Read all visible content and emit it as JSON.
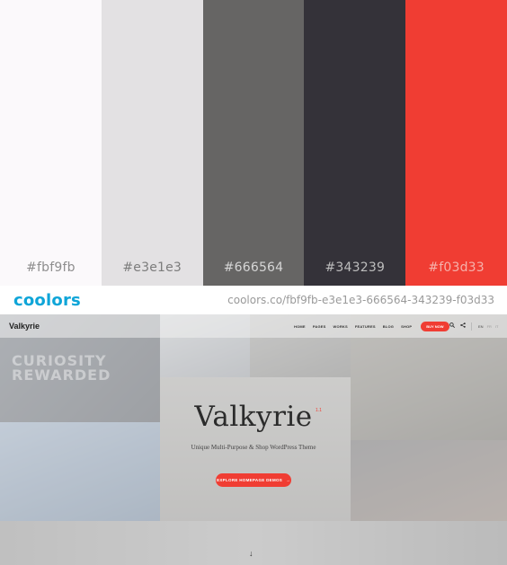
{
  "palette": {
    "swatches": [
      {
        "hex": "#fbf9fb",
        "label": "#fbf9fb",
        "label_color": "#8e8e8e"
      },
      {
        "hex": "#e3e1e3",
        "label": "#e3e1e3",
        "label_color": "#7c7c7c"
      },
      {
        "hex": "#666564",
        "label": "#666564",
        "label_color": "#d6d6d6"
      },
      {
        "hex": "#343239",
        "label": "#343239",
        "label_color": "#bdbdbd"
      },
      {
        "hex": "#f03d33",
        "label": "#f03d33",
        "label_color": "#f5b1ab"
      }
    ]
  },
  "coolors_bar": {
    "logo": "coolors",
    "url": "coolors.co/fbf9fb-e3e1e3-666564-343239-f03d33"
  },
  "site": {
    "logo": "Valkyrie",
    "nav": [
      "HOME",
      "PAGES",
      "WORKS",
      "FEATURES",
      "BLOG",
      "SHOP"
    ],
    "buy_label": "BUY NOW",
    "languages": [
      "EN",
      "FR",
      "IT"
    ],
    "ghost_lines": [
      "CURIOSITY",
      "REWARDED"
    ],
    "hero": {
      "title": "Valkyrie",
      "version": "1.1",
      "subtitle": "Unique Multi-Purpose & Shop WordPress Theme",
      "cta_label": "EXPLORE HOMEPAGE DEMOS",
      "cta_arrow": "→"
    },
    "scroll_arrow": "↓",
    "accent_color": "#f03d33"
  }
}
